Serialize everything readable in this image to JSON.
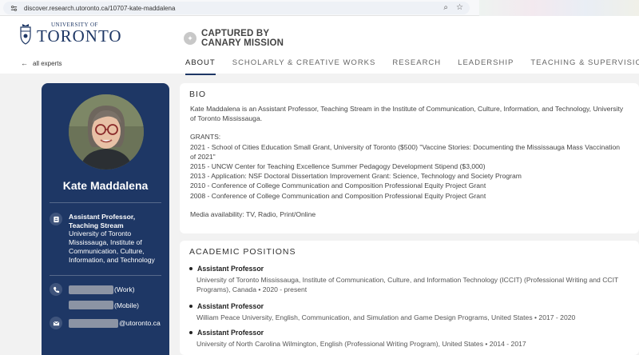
{
  "browser": {
    "url": "discover.research.utoronto.ca/10707-kate-maddalena"
  },
  "header": {
    "logo_small": "UNIVERSITY OF",
    "logo_big": "TORONTO",
    "captured_line1": "CAPTURED BY",
    "captured_line2": "CANARY MISSION",
    "back_label": "all experts",
    "tabs": [
      {
        "label": "ABOUT",
        "active": true
      },
      {
        "label": "SCHOLARLY & CREATIVE WORKS"
      },
      {
        "label": "RESEARCH"
      },
      {
        "label": "LEADERSHIP"
      },
      {
        "label": "TEACHING & SUPERVISION"
      }
    ]
  },
  "profile": {
    "name": "Kate Maddalena",
    "role_title": "Assistant Professor, Teaching Stream",
    "role_unit": "University of Toronto Mississauga, Institute of Communication, Culture, Information, and Technology",
    "phone_work": "(Work)",
    "phone_mobile": "(Mobile)",
    "email_domain": "@utoronto.ca"
  },
  "bio": {
    "heading": "BIO",
    "intro": "Kate Maddalena is an Assistant Professor, Teaching Stream in the Institute of Communication, Culture, Information, and Technology, University of Toronto Mississauga.",
    "grants_label": "GRANTS:",
    "grants": [
      "2021 - School of Cities Education Small Grant, University of Toronto ($500) \"Vaccine Stories: Documenting the Mississauga Mass Vaccination of 2021\"",
      "2015 - UNCW Center for Teaching Excellence Summer Pedagogy Development Stipend ($3,000)",
      "2013 - Application: NSF Doctoral Dissertation Improvement Grant: Science, Technology and Society Program",
      "2010 - Conference of College Communication and Composition Professional Equity Project Grant",
      "2008 - Conference of College Communication and Composition Professional Equity Project Grant"
    ],
    "media": "Media availability: TV, Radio, Print/Online"
  },
  "academic": {
    "heading": "ACADEMIC POSITIONS",
    "positions": [
      {
        "title": "Assistant Professor",
        "detail": "University of Toronto Mississauga, Institute of Communication, Culture, and Information Technology (ICCIT) (Professional Writing and CCIT Programs), Canada  •  2020 - present"
      },
      {
        "title": "Assistant Professor",
        "detail": "William Peace University, English, Communication, and Simulation and Game Design Programs, United States  •  2017 - 2020"
      },
      {
        "title": "Assistant Professor",
        "detail": "University of North Carolina Wilmington, English (Professional Writing Program), United States  •  2014 - 2017"
      }
    ]
  },
  "colors": {
    "brand_navy": "#1e3765"
  }
}
